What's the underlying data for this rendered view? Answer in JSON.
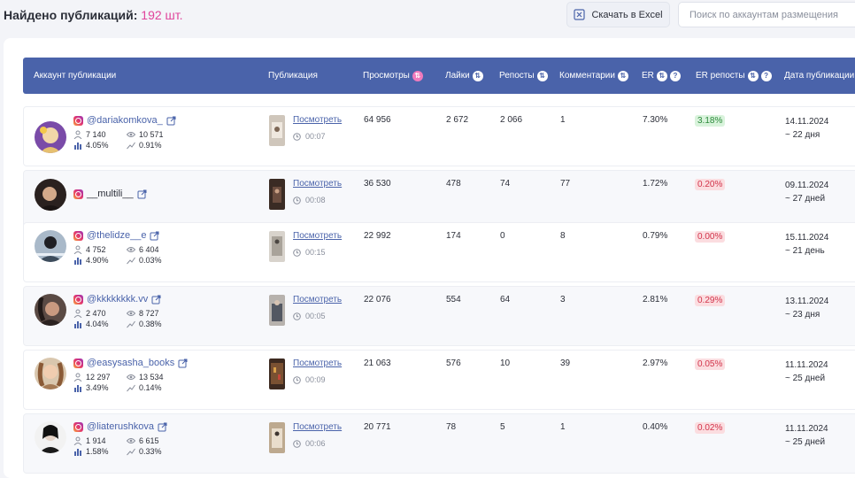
{
  "header": {
    "found_label": "Найдено публикаций:",
    "found_count": "192 шт.",
    "excel_label": "Скачать в Excel",
    "search_placeholder": "Поиск по аккаунтам размещения"
  },
  "columns": {
    "account": "Аккаунт публикации",
    "publication": "Публикация",
    "views": "Просмотры",
    "likes": "Лайки",
    "reposts": "Репосты",
    "comments": "Комментарии",
    "er": "ER",
    "er_reposts": "ER репосты",
    "date": "Дата публикации"
  },
  "rows": [
    {
      "handle": "@dariakomkova_",
      "followers": "7 140",
      "avg_views": "10 571",
      "er_stat": "4.05%",
      "growth": "0.91%",
      "view_link": "Посмотреть",
      "duration": "00:07",
      "views": "64 956",
      "likes": "2 672",
      "reposts": "2 066",
      "comments": "1",
      "er": "7.30%",
      "er_reposts": "3.18%",
      "date": "14.11.2024",
      "ago": "~ 22 дня"
    },
    {
      "handle": "__multili__",
      "view_link": "Посмотреть",
      "duration": "00:08",
      "views": "36 530",
      "likes": "478",
      "reposts": "74",
      "comments": "77",
      "er": "1.72%",
      "er_reposts": "0.20%",
      "date": "09.11.2024",
      "ago": "~ 27 дней"
    },
    {
      "handle": "@thelidze__e",
      "followers": "4 752",
      "avg_views": "6 404",
      "er_stat": "4.90%",
      "growth": "0.03%",
      "view_link": "Посмотреть",
      "duration": "00:15",
      "views": "22 992",
      "likes": "174",
      "reposts": "0",
      "comments": "8",
      "er": "0.79%",
      "er_reposts": "0.00%",
      "date": "15.11.2024",
      "ago": "~ 21 день"
    },
    {
      "handle": "@kkkkkkkk.vv",
      "followers": "2 470",
      "avg_views": "8 727",
      "er_stat": "4.04%",
      "growth": "0.38%",
      "view_link": "Посмотреть",
      "duration": "00:05",
      "views": "22 076",
      "likes": "554",
      "reposts": "64",
      "comments": "3",
      "er": "2.81%",
      "er_reposts": "0.29%",
      "date": "13.11.2024",
      "ago": "~ 23 дня"
    },
    {
      "handle": "@easysasha_books",
      "followers": "12 297",
      "avg_views": "13 534",
      "er_stat": "3.49%",
      "growth": "0.14%",
      "view_link": "Посмотреть",
      "duration": "00:09",
      "views": "21 063",
      "likes": "576",
      "reposts": "10",
      "comments": "39",
      "er": "2.97%",
      "er_reposts": "0.05%",
      "date": "11.11.2024",
      "ago": "~ 25 дней"
    },
    {
      "handle": "@liaterushkova",
      "followers": "1 914",
      "avg_views": "6 615",
      "er_stat": "1.58%",
      "growth": "0.33%",
      "view_link": "Посмотреть",
      "duration": "00:06",
      "views": "20 771",
      "likes": "78",
      "reposts": "5",
      "comments": "1",
      "er": "0.40%",
      "er_reposts": "0.02%",
      "date": "11.11.2024",
      "ago": "~ 25 дней"
    }
  ],
  "colors": {
    "header_bg": "#4a63aa",
    "accent_pink": "#e0449b",
    "link": "#4a63aa",
    "positive": "#2c8a3a",
    "negative": "#d2334a"
  }
}
